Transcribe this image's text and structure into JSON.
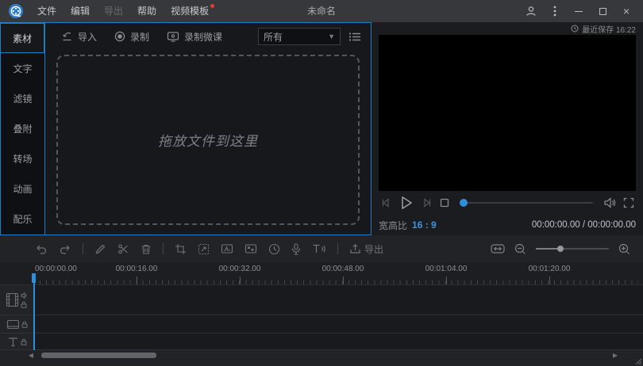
{
  "colors": {
    "accent": "#1f7dc4",
    "playhead": "#2e8fd8",
    "badge": "#e23b3b",
    "aspect_blue": "#3d95dd"
  },
  "titlebar": {
    "title": "未命名",
    "menus": [
      {
        "label": "文件",
        "enabled": true
      },
      {
        "label": "编辑",
        "enabled": true
      },
      {
        "label": "导出",
        "enabled": false
      },
      {
        "label": "帮助",
        "enabled": true
      },
      {
        "label": "视频模板",
        "enabled": true,
        "badge": true
      }
    ]
  },
  "sidebar": {
    "items": [
      {
        "label": "素材",
        "active": true
      },
      {
        "label": "文字",
        "active": false
      },
      {
        "label": "滤镜",
        "active": false
      },
      {
        "label": "叠附",
        "active": false
      },
      {
        "label": "转场",
        "active": false
      },
      {
        "label": "动画",
        "active": false
      },
      {
        "label": "配乐",
        "active": false
      }
    ]
  },
  "media_panel": {
    "import_label": "导入",
    "record_label": "录制",
    "record_lesson_label": "录制微课",
    "filter_value": "所有",
    "dropzone_text": "拖放文件到这里"
  },
  "preview": {
    "saved_text": "最近保存 16:22",
    "aspect_label": "宽高比",
    "aspect_value": "16 : 9",
    "timecode": "00:00:00.00 / 00:00:00.00"
  },
  "timeline": {
    "export_label": "导出",
    "ruler_labels": [
      "00:00:00.00",
      "00:00:16.00",
      "00:00:32.00",
      "00:00:48.00",
      "00:01:04.00",
      "00:01:20.00"
    ],
    "tracks": [
      {
        "name": "video"
      },
      {
        "name": "overlay"
      },
      {
        "name": "text"
      }
    ]
  }
}
